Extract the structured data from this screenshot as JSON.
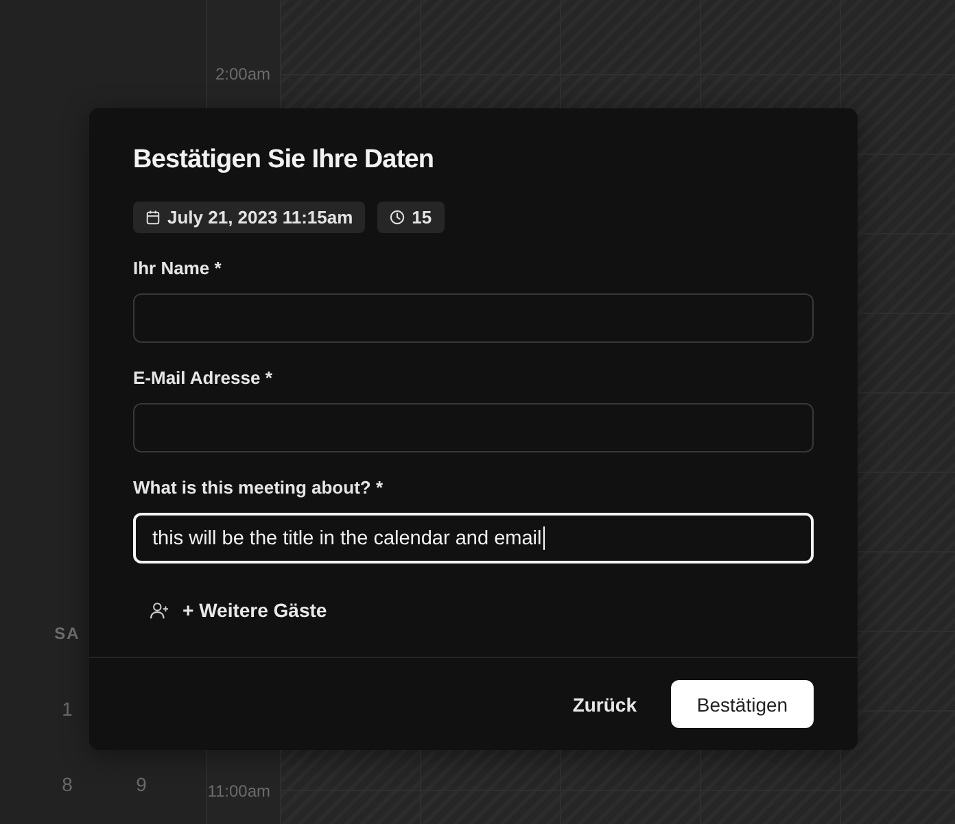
{
  "calendar": {
    "weekday_header": "SA",
    "weeks": [
      [
        "1"
      ],
      [
        "8",
        "9"
      ]
    ],
    "times": [
      "2:00am",
      "11:00am"
    ]
  },
  "dialog": {
    "title": "Bestätigen Sie Ihre Daten",
    "chips": [
      {
        "kind": "date",
        "label": "July 21, 2023 11:15am"
      },
      {
        "kind": "duration",
        "label": "15"
      }
    ],
    "fields": [
      {
        "label": "Ihr Name *",
        "focused": false
      },
      {
        "label": "E-Mail Adresse *",
        "focused": false
      },
      {
        "label": "What is this meeting about? *",
        "value": "this will be the title in the calendar and email",
        "focused": true
      }
    ],
    "add_guests_button": {
      "label": "+ Weitere Gäste"
    },
    "buttons": [
      {
        "kind": "secondary",
        "label": "Zurück"
      },
      {
        "kind": "primary",
        "label": "Bestätigen"
      }
    ]
  }
}
